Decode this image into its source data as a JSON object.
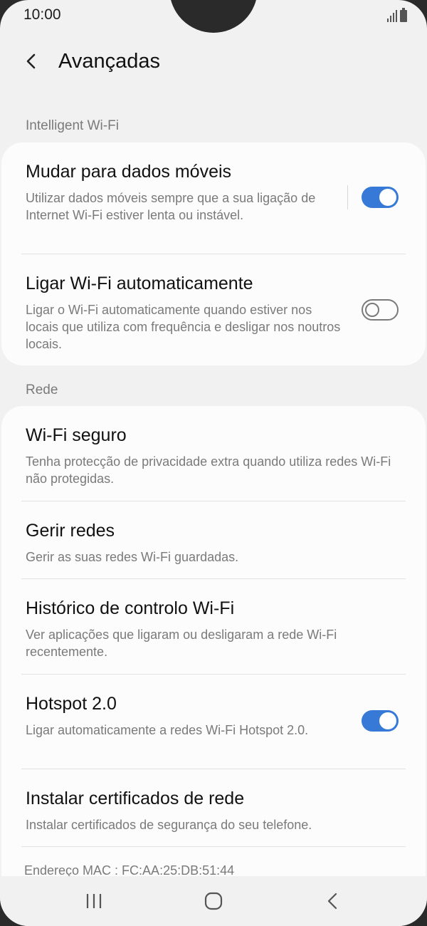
{
  "status_bar": {
    "time": "10:00"
  },
  "header": {
    "title": "Avançadas"
  },
  "sections": {
    "intelligent": "Intelligent Wi-Fi",
    "rede": "Rede"
  },
  "intelligent_items": [
    {
      "title": "Mudar para dados móveis",
      "description": "Utilizar dados móveis sempre que a sua ligação de Internet Wi-Fi estiver lenta ou instável.",
      "toggle": "on"
    },
    {
      "title": "Ligar Wi-Fi automaticamente",
      "description": "Ligar o Wi-Fi automaticamente quando estiver nos locais que utiliza com frequência e desligar nos noutros locais.",
      "toggle": "off"
    }
  ],
  "rede_items": [
    {
      "title": "Wi-Fi seguro",
      "description": "Tenha protecção de privacidade extra quando utiliza redes Wi-Fi não protegidas."
    },
    {
      "title": "Gerir redes",
      "description": "Gerir as suas redes Wi-Fi guardadas."
    },
    {
      "title": "Histórico de controlo Wi-Fi",
      "description": "Ver aplicações que ligaram ou desligaram a rede Wi-Fi recentemente."
    },
    {
      "title": "Hotspot 2.0",
      "description": "Ligar automaticamente a redes Wi-Fi Hotspot 2.0.",
      "toggle": "on"
    },
    {
      "title": "Instalar certificados de rede",
      "description": "Instalar certificados de segurança do seu telefone."
    }
  ],
  "mac_address": "Endereço MAC : FC:AA:25:DB:51:44",
  "colors": {
    "accent": "#3679d6",
    "background": "#f1f1f1",
    "card": "#fcfcfc"
  },
  "icons": {
    "back": "chevron-left-icon",
    "recents": "recents-icon",
    "home": "home-icon",
    "nav_back": "nav-back-icon"
  }
}
